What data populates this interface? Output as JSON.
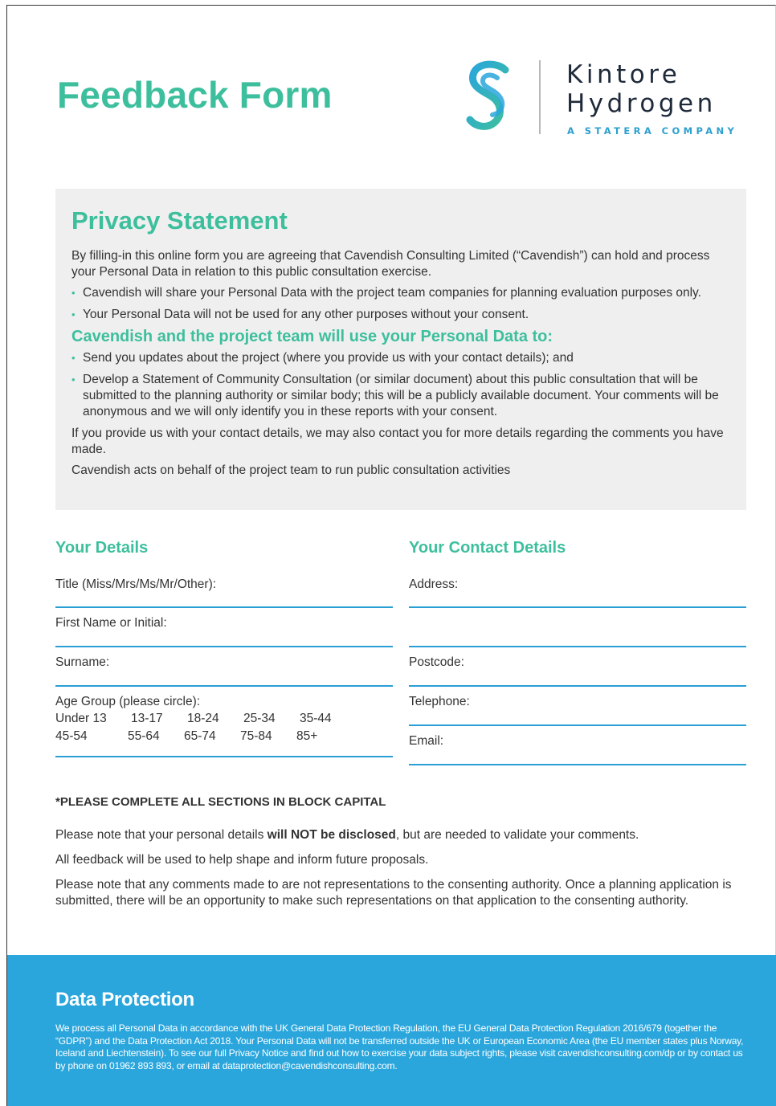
{
  "header": {
    "title": "Feedback Form",
    "logo": {
      "line1": "Kintore",
      "line2": "Hydrogen",
      "tagline": "A STATERA COMPANY",
      "brand_color_teal": "#3dbf9d",
      "brand_color_blue": "#2aa6dc"
    }
  },
  "privacy": {
    "heading": "Privacy Statement",
    "intro": "By filling-in this online form you are agreeing that Cavendish Consulting Limited (“Cavendish”) can hold and process your Personal Data in relation to this public consultation exercise.",
    "bullets_1": [
      "Cavendish will share your Personal Data with the project team companies for planning evaluation purposes only.",
      "Your Personal Data will not be used for any other purposes without your consent."
    ],
    "subheading": "Cavendish and the project team will use your Personal Data to:",
    "bullets_2": [
      "Send you updates about the project (where you provide us with your contact details); and",
      "Develop a Statement of Community Consultation (or similar document) about this public consultation that will be submitted to the planning authority or similar body; this will be a publicly available document. Your comments will be anonymous and we will only identify you in these reports with your consent."
    ],
    "para_contact": "If you provide us with your contact details, we may also contact you for more details regarding the comments you have made.",
    "para_behalf": "Cavendish acts on behalf of the project team to run public consultation activities"
  },
  "your_details": {
    "heading": "Your Details",
    "title_label": "Title (Miss/Mrs/Ms/Mr/Other):",
    "first_name_label": "First Name or Initial:",
    "surname_label": "Surname:",
    "age_label": "Age Group (please circle):",
    "age_row_1": [
      "Under 13",
      "13-17",
      "18-24",
      "25-34",
      "35-44"
    ],
    "age_row_2": [
      "45-54",
      "55-64",
      "65-74",
      "75-84",
      "85+"
    ]
  },
  "contact_details": {
    "heading": "Your Contact Details",
    "address_label": "Address:",
    "postcode_label": "Postcode:",
    "telephone_label": "Telephone:",
    "email_label": "Email:"
  },
  "notice": {
    "caps": "*PLEASE COMPLETE ALL SECTIONS IN BLOCK CAPITAL",
    "disclosed_before": "Please note that your personal details ",
    "disclosed_bold": "will NOT be disclosed",
    "disclosed_after": ", but are needed to validate your comments.",
    "feedback": "All feedback will be used to help shape and inform future proposals.",
    "representations": "Please note that any comments made to are not representations to the consenting authority. Once a planning application is submitted, there will be an opportunity to make such representations on that application to the consenting authority."
  },
  "data_protection": {
    "heading": "Data Protection",
    "body": "We process all Personal Data in accordance with the UK General Data Protection Regulation, the EU General Data Protection Regulation 2016/679 (together the “GDPR”) and the Data Protection Act 2018. Your Personal Data will not be transferred outside the UK or European Economic Area (the EU member states plus Norway, Iceland and Liechtenstein). To see our full Privacy Notice and find out how to exercise your data subject rights, please visit cavendishconsulting.com/dp or by contact us by phone on 01962 893 893, or email at dataprotection@cavendishconsulting.com."
  }
}
